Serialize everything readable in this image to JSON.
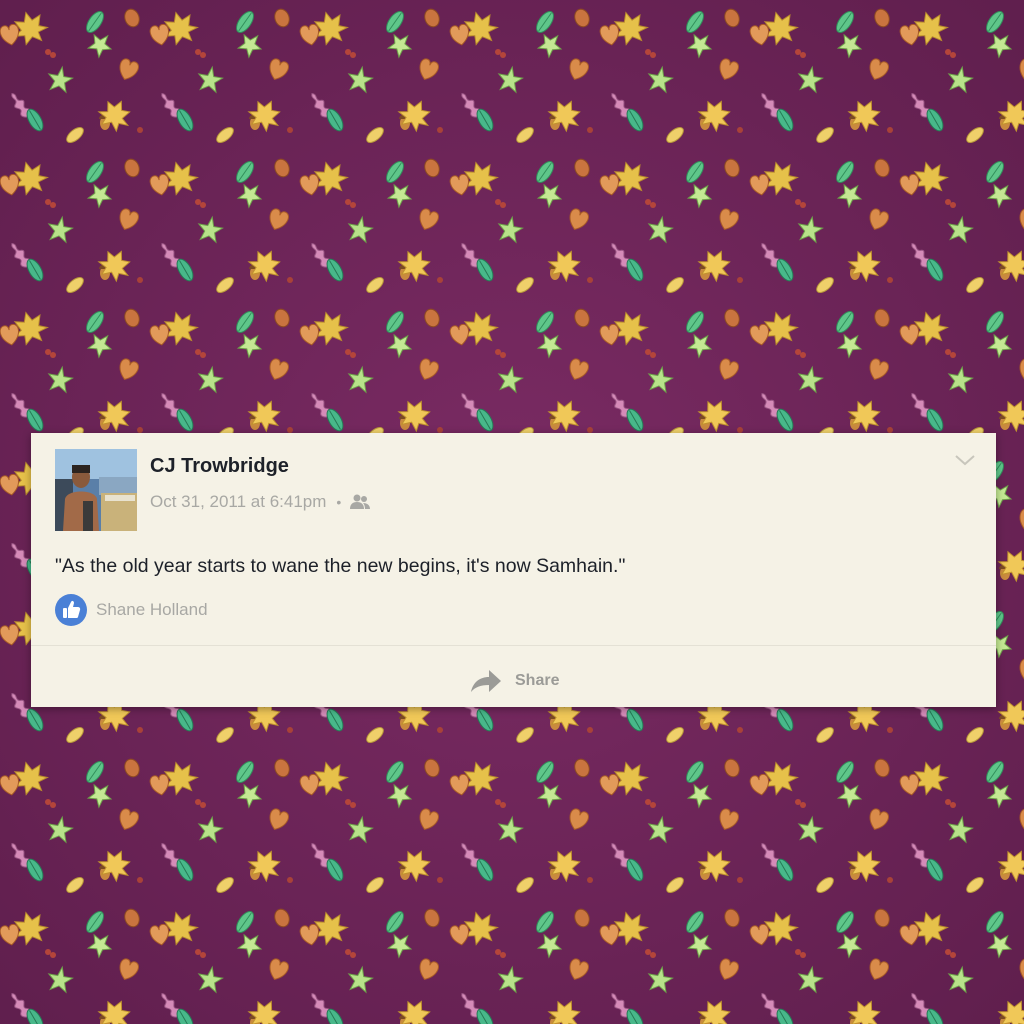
{
  "post": {
    "author": "CJ Trowbridge",
    "timestamp": "Oct 31, 2011 at 6:41pm",
    "separator": "•",
    "audience_icon": "friends-icon",
    "options_icon": "chevron-down-icon",
    "text": "\"As the old year starts to wane the new begins, it's now Samhain.\"",
    "like_icon": "thumbs-up-icon",
    "liked_by": "Shane Holland",
    "share_icon": "share-arrow-icon",
    "share_label": "Share"
  },
  "colors": {
    "background": "#6b2457",
    "card": "#f5f2e6",
    "author_text": "#1d2129",
    "meta_text": "#a8a8a4",
    "like_blue": "#4a80d6"
  }
}
